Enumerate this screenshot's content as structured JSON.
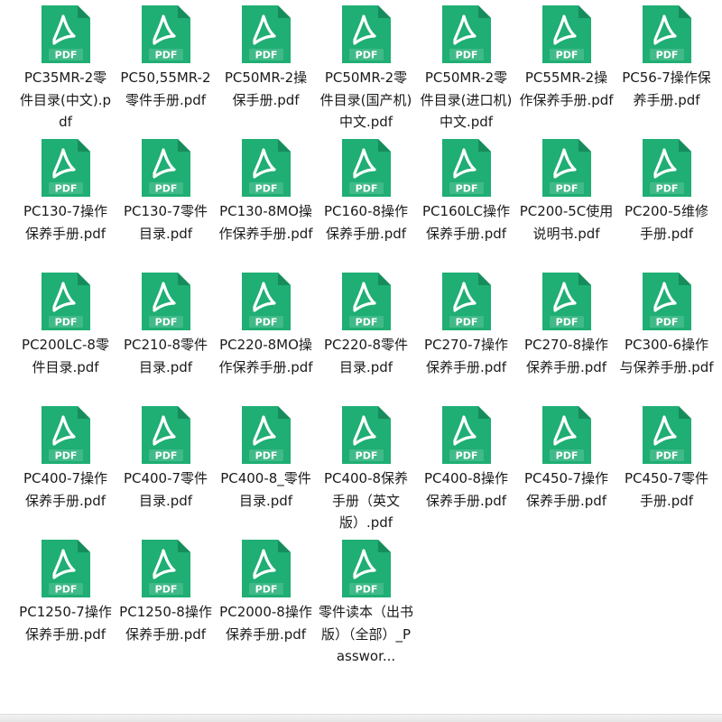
{
  "colors": {
    "icon_green": "#1fae74",
    "icon_green_dark": "#168c5c",
    "icon_white": "#ffffff",
    "text": "#1a1a1a",
    "background": "#ffffff"
  },
  "icon": {
    "name": "pdf-file-icon",
    "badge_text": "PDF"
  },
  "files": [
    {
      "name": "",
      "partial": true
    },
    {
      "name": "PC35MR-2零件目录(中文).pdf"
    },
    {
      "name": "PC50,55MR-2零件手册.pdf"
    },
    {
      "name": "PC50MR-2操保手册.pdf"
    },
    {
      "name": "PC50MR-2零件目录(国产机)中文.pdf"
    },
    {
      "name": "PC50MR-2零件目录(进口机)中文.pdf"
    },
    {
      "name": "PC55MR-2操作保养手册.pdf"
    },
    {
      "name": "PC56-7操作保养手册.pdf"
    },
    {
      "name": "",
      "partial": true
    },
    {
      "name": "PC130-7操作保养手册.pdf"
    },
    {
      "name": "PC130-7零件目录.pdf"
    },
    {
      "name": "PC130-8MO操作保养手册.pdf"
    },
    {
      "name": "PC160-8操作保养手册.pdf"
    },
    {
      "name": "PC160LC操作保养手册.pdf"
    },
    {
      "name": "PC200-5C使用说明书.pdf"
    },
    {
      "name": "PC200-5维修手册.pdf"
    },
    {
      "name": "",
      "partial": true
    },
    {
      "name": "PC200LC-8零件目录.pdf"
    },
    {
      "name": "PC210-8零件目录.pdf"
    },
    {
      "name": "PC220-8MO操作保养手册.pdf"
    },
    {
      "name": "PC220-8零件目录.pdf"
    },
    {
      "name": "PC270-7操作保养手册.pdf"
    },
    {
      "name": "PC270-8操作保养手册.pdf"
    },
    {
      "name": "PC300-6操作与保养手册.pdf"
    },
    {
      "name": "",
      "partial": true
    },
    {
      "name": "PC400-7操作保养手册.pdf"
    },
    {
      "name": "PC400-7零件目录.pdf"
    },
    {
      "name": "PC400-8_零件目录.pdf"
    },
    {
      "name": "PC400-8保养手册（英文版）.pdf"
    },
    {
      "name": "PC400-8操作保养手册.pdf"
    },
    {
      "name": "PC450-7操作保养手册.pdf"
    },
    {
      "name": "PC450-7零件手册.pdf"
    },
    {
      "name": "",
      "partial": true
    },
    {
      "name": "PC1250-7操作保养手册.pdf"
    },
    {
      "name": "PC1250-8操作保养手册.pdf"
    },
    {
      "name": "PC2000-8操作保养手册.pdf"
    },
    {
      "name": "零件读本（出书版）（全部）_Passwor..."
    }
  ]
}
